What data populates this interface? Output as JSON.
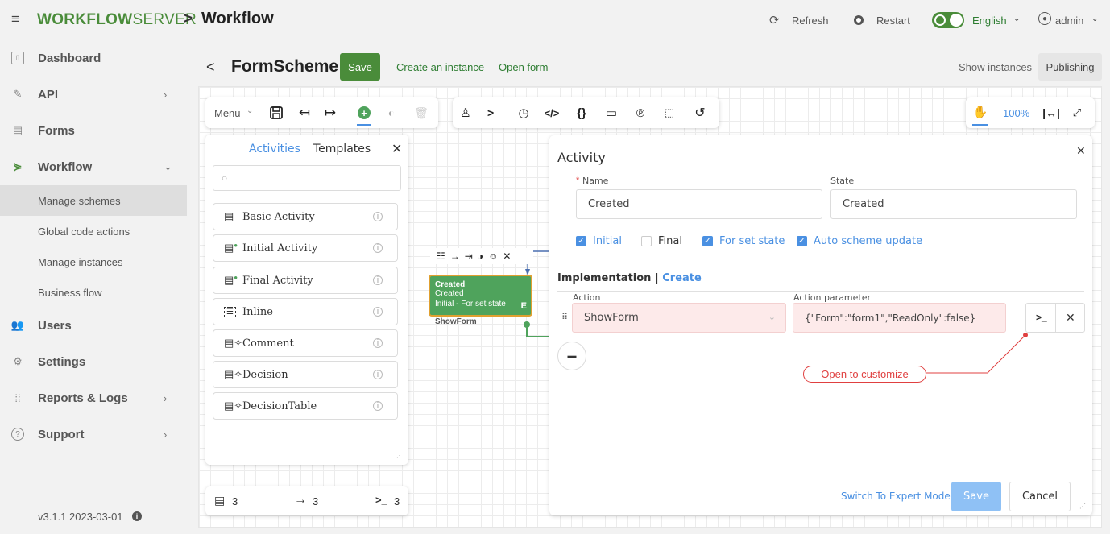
{
  "header": {
    "logo_bold": "WORKFLOW",
    "logo_light": "SERVER",
    "separator": ">",
    "title": "Workflow",
    "refresh_label": "Refresh",
    "restart_label": "Restart",
    "language": "English",
    "user": "admin"
  },
  "sidebar": {
    "items": [
      {
        "label": "Dashboard"
      },
      {
        "label": "API"
      },
      {
        "label": "Forms"
      },
      {
        "label": "Workflow"
      },
      {
        "label": "Users"
      },
      {
        "label": "Settings"
      },
      {
        "label": "Reports & Logs"
      },
      {
        "label": "Support"
      }
    ],
    "sub_items": [
      {
        "label": "Manage schemes"
      },
      {
        "label": "Global code actions"
      },
      {
        "label": "Manage instances"
      },
      {
        "label": "Business flow"
      }
    ],
    "version": "v3.1.1 2023-03-01"
  },
  "scheme": {
    "back": "<",
    "title": "FormScheme",
    "save_label": "Save",
    "create_instance": "Create an instance",
    "open_form": "Open form",
    "show_instances": "Show instances",
    "publishing": "Publishing"
  },
  "toolbar": {
    "menu_label": "Menu",
    "zoom": "100%"
  },
  "activities_panel": {
    "tab_activities": "Activities",
    "tab_templates": "Templates",
    "search_placeholder": "",
    "items": [
      {
        "label": "Basic Activity"
      },
      {
        "label": "Initial Activity"
      },
      {
        "label": "Final Activity"
      },
      {
        "label": "Inline"
      },
      {
        "label": "Comment"
      },
      {
        "label": "Decision"
      },
      {
        "label": "DecisionTable"
      }
    ]
  },
  "stats": {
    "activities": "3",
    "transitions": "3",
    "actions": "3"
  },
  "node": {
    "line1": "Created",
    "line2": "Created",
    "line3": "Initial - For set state",
    "badge": "E",
    "below": "ShowForm"
  },
  "activity_dialog": {
    "title": "Activity",
    "name_label": "Name",
    "name_required": "*",
    "name_value": "Created",
    "state_label": "State",
    "state_value": "Created",
    "checkboxes": [
      {
        "label": "Initial",
        "checked": true
      },
      {
        "label": "Final",
        "checked": false
      },
      {
        "label": "For set state",
        "checked": true
      },
      {
        "label": "Auto scheme update",
        "checked": true
      }
    ],
    "implementation_label": "Implementation",
    "implementation_sep": "|",
    "implementation_create": "Create",
    "action_label": "Action",
    "action_param_label": "Action parameter",
    "action_value": "ShowForm",
    "action_param_value": "{\"Form\":\"form1\",\"ReadOnly\":false}",
    "callout": "Open to customize",
    "expert_mode": "Switch To Expert Mode",
    "save_label": "Save",
    "cancel_label": "Cancel"
  },
  "colors": {
    "brand_green": "#4a8c3a",
    "link_blue": "#4a90e2",
    "node_green": "#4fa35c",
    "node_border": "#e0a030",
    "callout_red": "#e04040",
    "action_bg": "#fdeaea"
  }
}
